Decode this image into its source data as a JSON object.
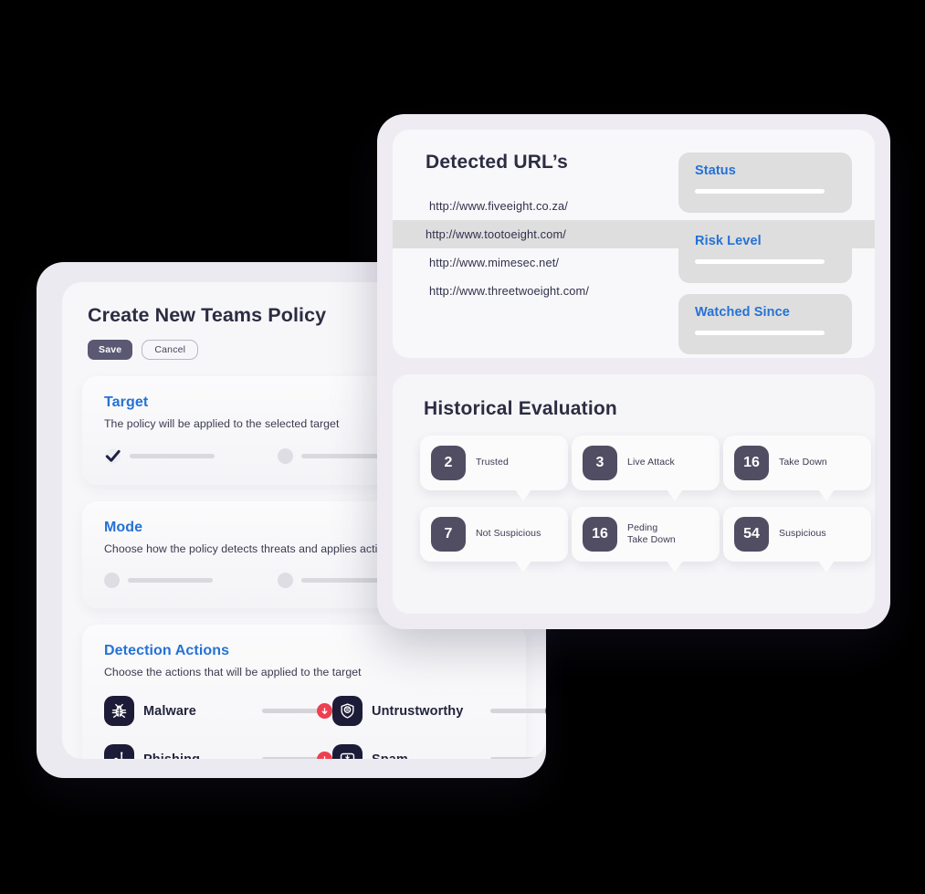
{
  "policy": {
    "title": "Create New Teams Policy",
    "save_label": "Save",
    "cancel_label": "Cancel",
    "sections": [
      {
        "title": "Target",
        "subtitle": "The policy will be applied to the selected target",
        "options": [
          {
            "state": "checked"
          },
          {
            "state": "unchecked"
          }
        ]
      },
      {
        "title": "Mode",
        "subtitle": "Choose how the policy detects threats and applies actions",
        "options": [
          {
            "state": "unchecked"
          },
          {
            "state": "unchecked"
          }
        ]
      }
    ],
    "detection": {
      "title": "Detection Actions",
      "subtitle": "Choose the actions that will be applied to the target",
      "actions": [
        {
          "label": "Malware",
          "icon": "bug-icon"
        },
        {
          "label": "Untrustworthy",
          "icon": "shield-lines-icon"
        },
        {
          "label": "Phishing",
          "icon": "fish-hook-icon"
        },
        {
          "label": "Spam",
          "icon": "inbox-icon"
        }
      ],
      "badge_icon": "arrow-down-icon"
    }
  },
  "threat": {
    "urls_title": "Detected URL’s",
    "urls": [
      {
        "url": "http://www.fiveeight.co.za/",
        "selected": false
      },
      {
        "url": "http://www.tootoeight.com/",
        "selected": true
      },
      {
        "url": "http://www.mimesec.net/",
        "selected": false
      },
      {
        "url": "http://www.threetwoeight.com/",
        "selected": false
      }
    ],
    "meta": [
      {
        "label": "Status"
      },
      {
        "label": "Risk Level"
      },
      {
        "label": "Watched Since"
      }
    ],
    "history_title": "Historical Evaluation",
    "stats": [
      {
        "value": "2",
        "label": "Trusted"
      },
      {
        "value": "3",
        "label": "Live Attack"
      },
      {
        "value": "16",
        "label": "Take Down"
      },
      {
        "value": "7",
        "label": "Not Suspicious"
      },
      {
        "value": "16",
        "label": "Peding\nTake Down"
      },
      {
        "value": "54",
        "label": "Suspicious"
      }
    ]
  },
  "colors": {
    "accent_blue": "#2572d4",
    "dark_navy": "#1c1c38",
    "slate": "#514d63",
    "danger_red": "#ef4050",
    "title_text": "#2c2c43"
  }
}
